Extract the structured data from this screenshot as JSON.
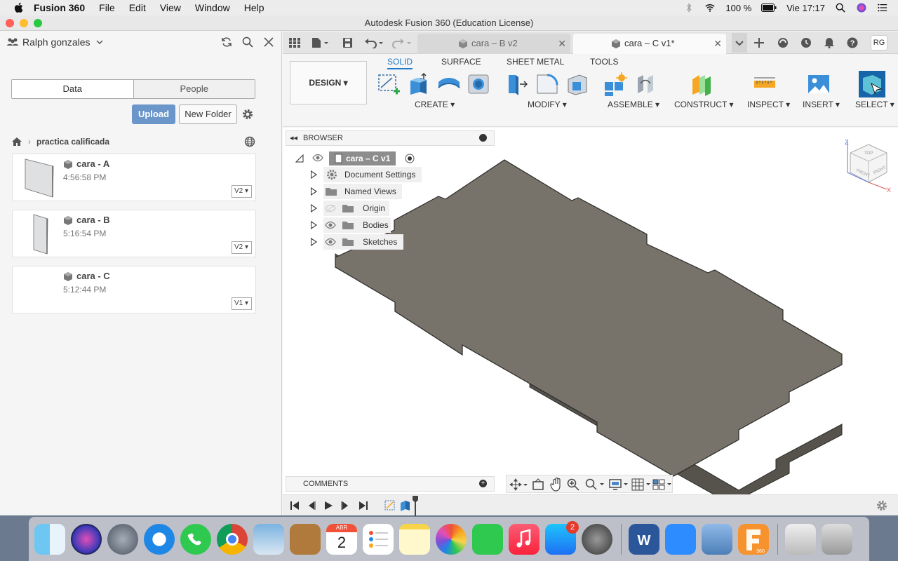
{
  "menubar": {
    "app_name": "Fusion 360",
    "items": [
      "File",
      "Edit",
      "View",
      "Window",
      "Help"
    ],
    "battery": "100 %",
    "datetime": "Vie 17:17"
  },
  "window": {
    "title": "Autodesk Fusion 360 (Education License)"
  },
  "data_panel": {
    "user": "Ralph gonzales",
    "tabs": [
      "Data",
      "People"
    ],
    "upload_label": "Upload",
    "new_folder_label": "New Folder",
    "breadcrumb": "practica calificada",
    "files": [
      {
        "name": "cara - A",
        "time": "4:56:58 PM",
        "version": "V2"
      },
      {
        "name": "cara - B",
        "time": "5:16:54 PM",
        "version": "V2"
      },
      {
        "name": "cara - C",
        "time": "5:12:44 PM",
        "version": "V1"
      }
    ]
  },
  "doc_tabs": [
    {
      "label": "cara – B v2",
      "active": false
    },
    {
      "label": "cara – C v1*",
      "active": true
    }
  ],
  "user_initials": "RG",
  "toolbar": {
    "workspace": "DESIGN",
    "tabs": [
      "SOLID",
      "SURFACE",
      "SHEET METAL",
      "TOOLS"
    ],
    "groups": [
      "CREATE",
      "MODIFY",
      "ASSEMBLE",
      "CONSTRUCT",
      "INSPECT",
      "INSERT",
      "SELECT"
    ]
  },
  "browser": {
    "header": "BROWSER",
    "root": "cara – C v1",
    "items": [
      "Document Settings",
      "Named Views",
      "Origin",
      "Bodies",
      "Sketches"
    ]
  },
  "comments_label": "COMMENTS",
  "dock": {
    "calendar_month": "ABR",
    "calendar_day": "2",
    "appstore_badge": "2",
    "fusion_label": "360"
  },
  "colors": {
    "accent": "#1f7acb",
    "model_top": "#78736a",
    "model_side": "#5a5650",
    "upload": "#6a96c9"
  }
}
